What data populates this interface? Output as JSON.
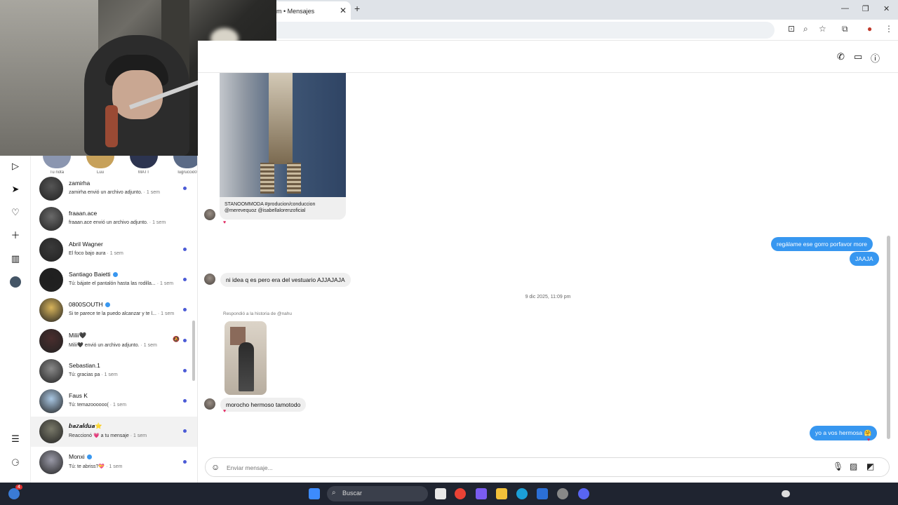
{
  "browser": {
    "tab_title": "m • Mensajes",
    "tab_close": "✕",
    "new_tab": "+",
    "minimize": "—",
    "restore": "❐",
    "close": "✕"
  },
  "stories": [
    {
      "name": "Tu nota",
      "color": "#8b96b0"
    },
    {
      "name": "Luu",
      "color": "#c7a15a"
    },
    {
      "name": "MATT",
      "color": "#2c3450"
    },
    {
      "name": "lugruccio0",
      "color": "#5a6a86"
    }
  ],
  "conversations": [
    {
      "name": "zamirha",
      "preview": "zamirha envió un archivo adjunto.",
      "time": "1 sem",
      "unread": true,
      "verified": false,
      "avatar_color": "#555"
    },
    {
      "name": "fraaan.ace",
      "preview": "fraaan.ace envió un archivo adjunto.",
      "time": "1 sem",
      "unread": false,
      "verified": false,
      "avatar_color": "#6a6a6a"
    },
    {
      "name": "Abril Wagner",
      "preview": "El foco bajo aura",
      "time": "1 sem",
      "unread": true,
      "verified": false,
      "avatar_color": "#3a3a3a"
    },
    {
      "name": "Santiago Baietti",
      "preview": "Tú: bájate el pantalón hasta las rodilla...",
      "time": "1 sem",
      "unread": true,
      "verified": true,
      "avatar_color": "#1f1f1f"
    },
    {
      "name": "0800SOUTH",
      "preview": "Si te parece te la puedo alcanzar y te l...",
      "time": "1 sem",
      "unread": true,
      "verified": true,
      "avatar_color": "#d8b45a"
    },
    {
      "name": "Milii🖤",
      "preview": "Milii🖤 envió un archivo adjunto.",
      "time": "1 sem",
      "unread": true,
      "verified": false,
      "avatar_color": "#4a2e2e"
    },
    {
      "name": "Sebastian.1",
      "preview": "Tú: gracias pa",
      "time": "1 sem",
      "unread": true,
      "verified": false,
      "avatar_color": "#8a8a8a"
    },
    {
      "name": "Faus K",
      "preview": "Tú: temazoooooo(",
      "time": "1 sem",
      "unread": true,
      "verified": false,
      "avatar_color": "#a9c7e3"
    },
    {
      "name": "𝒃𝒂𝒛𝒂𝒍𝒅𝒖𝒂⭐",
      "preview": "Reaccionó 💗 a tu mensaje",
      "time": "1 sem",
      "unread": true,
      "verified": false,
      "avatar_color": "#7a7a6a"
    },
    {
      "name": "Monxi",
      "preview": "Tú: te abriss?💝",
      "time": "1 sem",
      "unread": true,
      "verified": true,
      "avatar_color": "#9a9aa8"
    }
  ],
  "chat": {
    "post_caption": "STANOOMMODA #producion/conduccion @merevequoz @isabellalorenzoficial",
    "messages": {
      "out1": "regálame ese gorro porfavor more",
      "out2": "JAAJA",
      "in1": "ni idea q es pero era del vestuario AJJAJAJA",
      "date": "9 dic 2025, 11:09 pm",
      "reply_label": "Respondió a la historia de @nahu",
      "in2": "morocho hermoso tamotodo",
      "out3": "yo a vos hermosa 🤗"
    },
    "composer_placeholder": "Enviar mensaje..."
  },
  "taskbar": {
    "search_label": "Buscar",
    "notification_count": "4"
  }
}
